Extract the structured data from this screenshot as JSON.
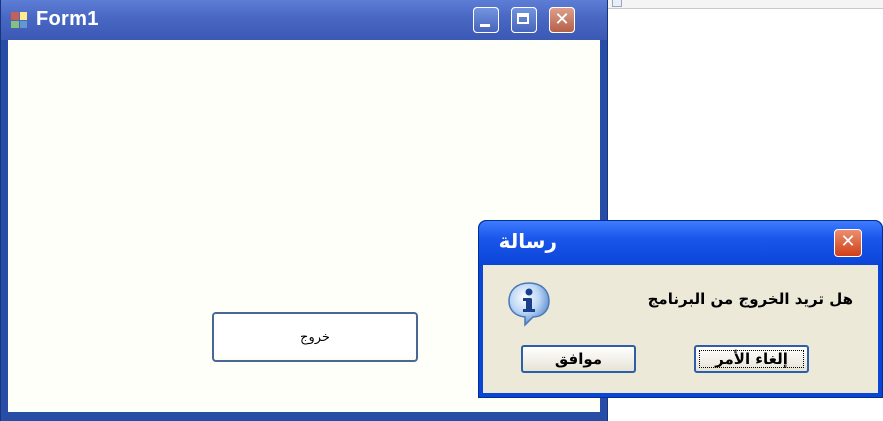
{
  "form": {
    "title": "Form1",
    "icon": "windows-form-icon",
    "controls": [
      "minimize-icon",
      "maximize-icon",
      "close-icon"
    ],
    "exit_button_label": "خروج"
  },
  "message_box": {
    "title": "رسالة",
    "text": "هل تريد الخروج من البرنامج",
    "icon": "information-icon",
    "buttons": {
      "ok_label": "موافق",
      "cancel_label": "إلغاء الأمر"
    }
  },
  "colors": {
    "xp_title_blue": "#0a46d6",
    "dialog_face": "#ece9d8",
    "close_red": "#d24a24",
    "button_border": "#2e5ea8"
  }
}
